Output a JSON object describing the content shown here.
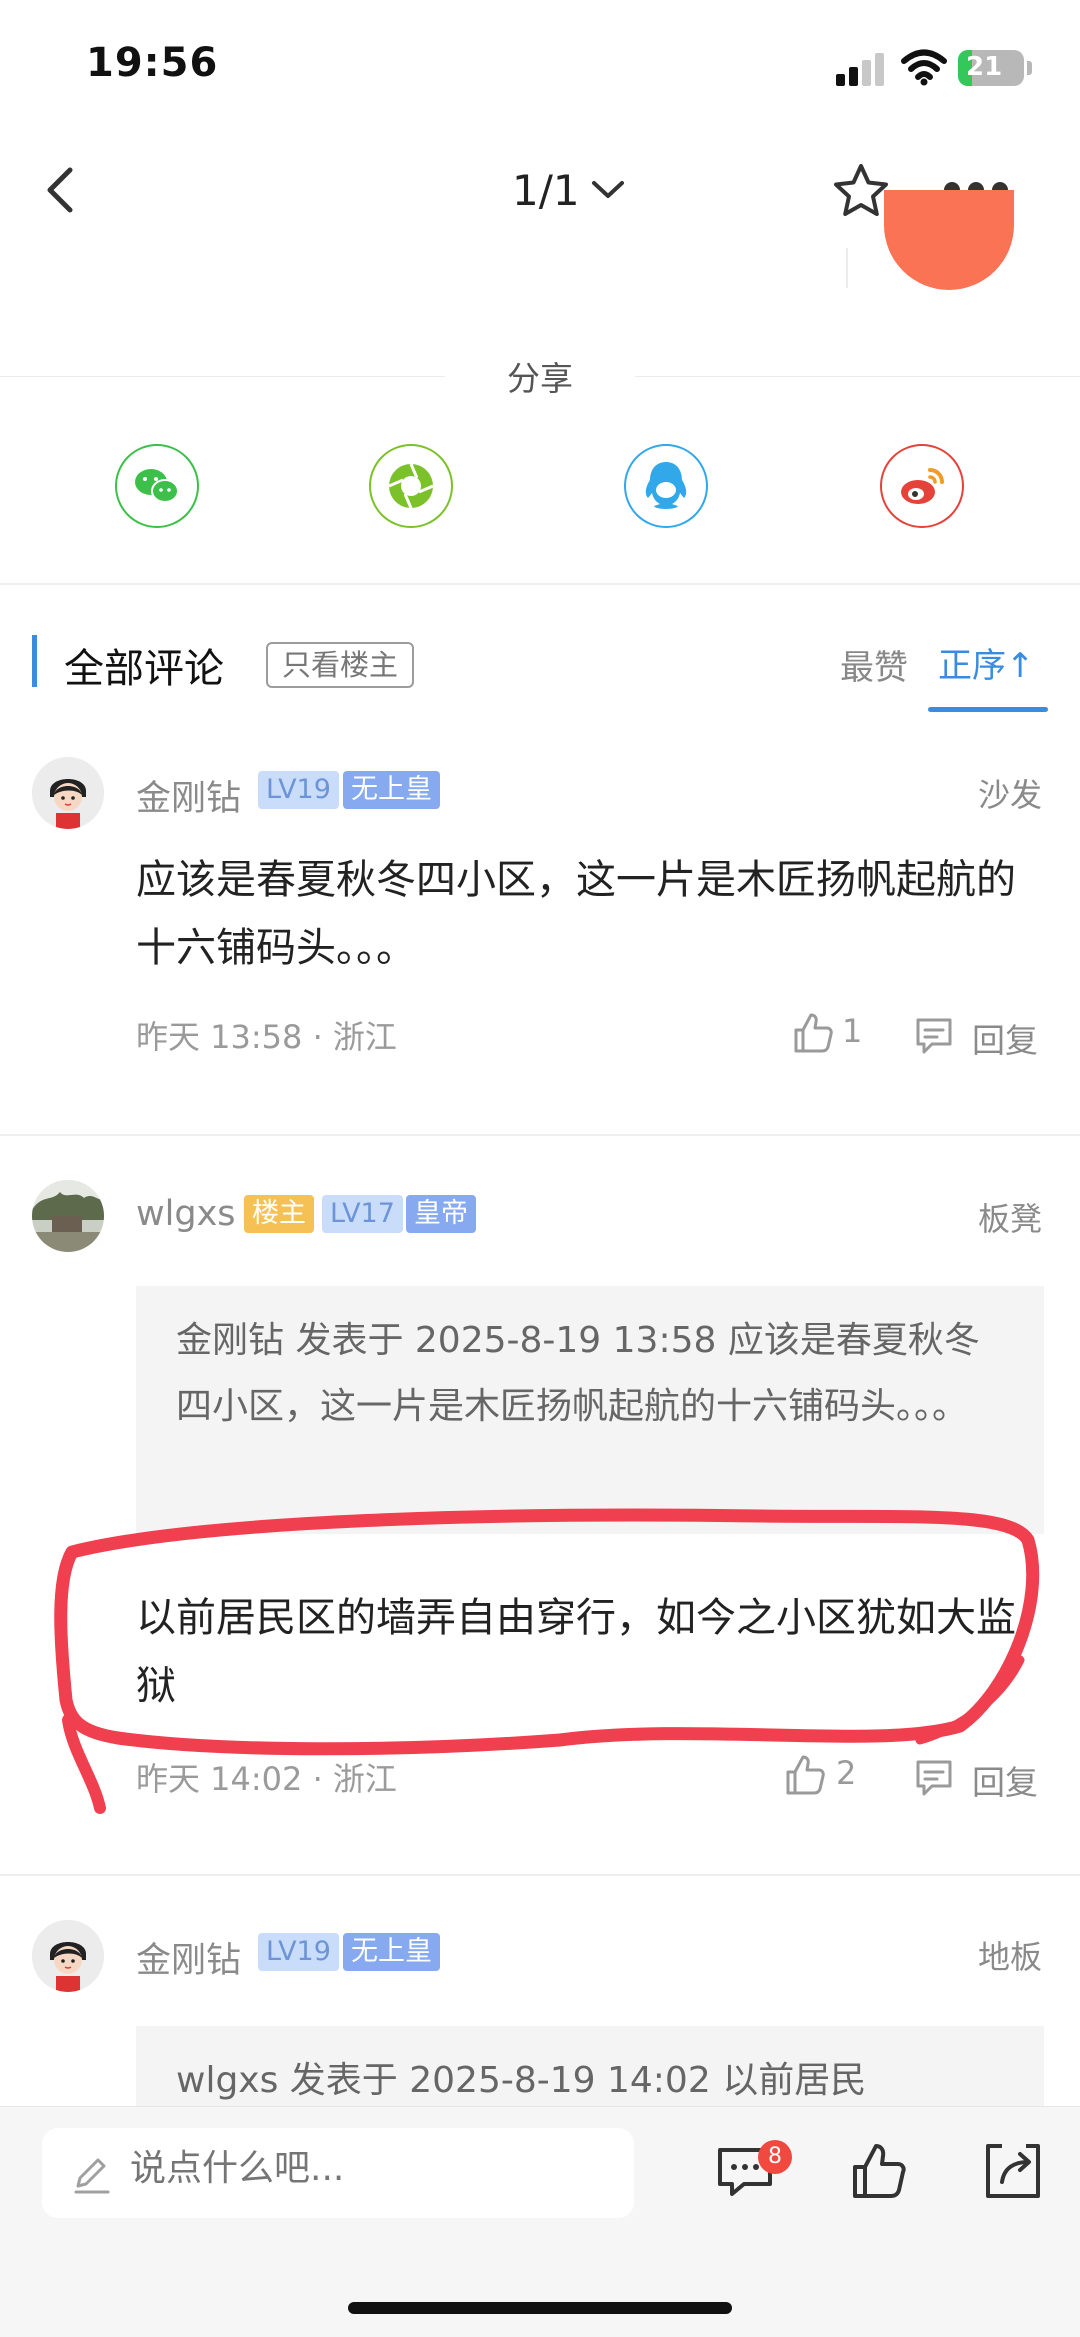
{
  "status_bar": {
    "time": "19:56",
    "battery": "21",
    "battery_level": 0.21
  },
  "nav": {
    "page_indicator": "1/1"
  },
  "share": {
    "title": "分享",
    "targets": [
      {
        "name": "wechat",
        "color": "#3cc04a"
      },
      {
        "name": "moments",
        "color": "#7bc12a"
      },
      {
        "name": "qq",
        "color": "#31a8ea"
      },
      {
        "name": "weibo",
        "color": "#e5433a"
      }
    ]
  },
  "comments_header": {
    "title": "全部评论",
    "op_only": "只看楼主",
    "sort_likes": "最赞",
    "sort_asc": "正序↑"
  },
  "comments": [
    {
      "user": "金刚钻",
      "level": "LV19",
      "rank": "无上皇",
      "floor": "沙发",
      "text": "应该是春夏秋冬四小区，这一片是木匠扬帆起航的十六铺码头。。。",
      "meta": "昨天 13:58 · 浙江",
      "likes": "1",
      "reply": "回复"
    },
    {
      "user": "wlgxs",
      "op_tag": "楼主",
      "level": "LV17",
      "rank": "皇帝",
      "floor": "板凳",
      "quote": "金刚钻 发表于 2025-8-19 13:58 应该是春夏秋冬四小区，这一片是木匠扬帆起航的十六铺码头。。。",
      "text": "以前居民区的墙弄自由穿行，如今之小区犹如大监狱",
      "meta": "昨天 14:02 · 浙江",
      "likes": "2",
      "reply": "回复"
    },
    {
      "user": "金刚钻",
      "level": "LV19",
      "rank": "无上皇",
      "floor": "地板",
      "quote": "wlgxs 发表于 2025-8-19 14:02 以前居民"
    }
  ],
  "bottom_bar": {
    "input_placeholder": "说点什么吧...",
    "comment_count": "8"
  },
  "colors": {
    "accent": "#3a8ce0",
    "annotation": "#f0404f"
  }
}
